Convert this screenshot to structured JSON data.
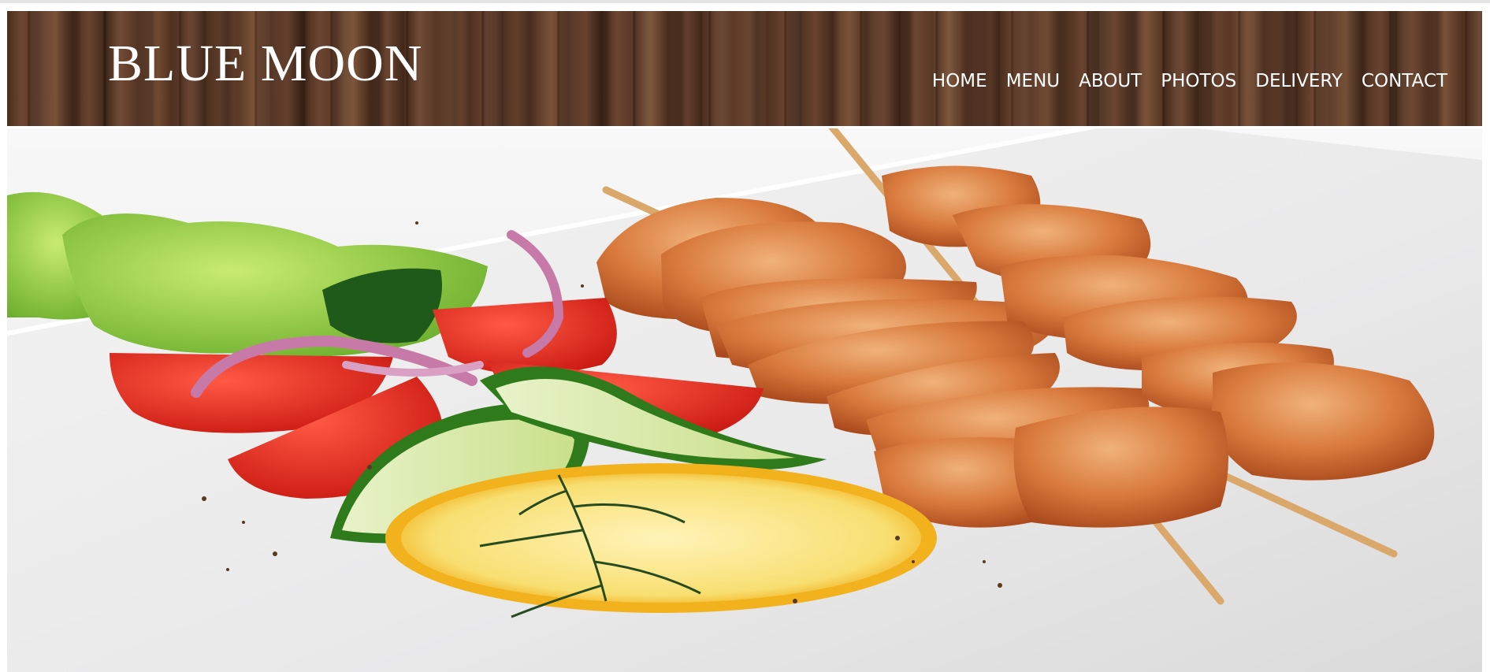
{
  "site": {
    "logo_text": "BLUE MOON"
  },
  "nav": {
    "items": [
      {
        "label": "HOME"
      },
      {
        "label": "MENU"
      },
      {
        "label": "ABOUT"
      },
      {
        "label": "PHOTOS"
      },
      {
        "label": "DELIVERY"
      },
      {
        "label": "CONTACT"
      }
    ]
  },
  "hero": {
    "image_subject": "grilled chicken skewers with salad",
    "icon": "hero-food-image"
  },
  "colors": {
    "header_wood": "#5b3a27",
    "nav_text": "#ffffff",
    "plate": "#ececec"
  }
}
